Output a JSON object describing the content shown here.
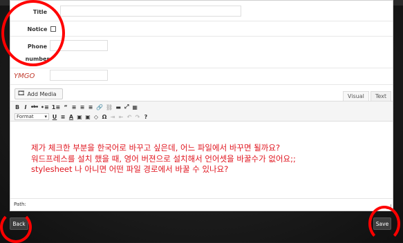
{
  "form": {
    "title_label": "Title",
    "title_value": "",
    "notice_label": "Notice",
    "notice_checked": false,
    "phone_label_1": "Phone",
    "phone_label_2": "number",
    "phone_value": "",
    "extra_label": "YMGO",
    "extra_value": ""
  },
  "editor": {
    "add_media_label": "Add Media",
    "tabs": [
      "Visual",
      "Text"
    ],
    "active_tab": "Visual",
    "toolbar_row1": [
      "B",
      "I",
      "abc",
      "•≡",
      "1≡",
      "“",
      "≡",
      "≡",
      "≡",
      "🔗",
      "⛓",
      "▬",
      "⤢",
      "▦"
    ],
    "toolbar_row2_format": "Format",
    "toolbar_row2": [
      "U",
      "≡",
      "A",
      "▣",
      "▣",
      "◇",
      "Ω",
      "⇥",
      "⇤",
      "↶",
      "↷",
      "?"
    ],
    "content_lines": [
      "제가 체크한 부분을 한국어로 바꾸고 싶은데, 어느 파일에서 바꾸면 될까요?",
      "워드프레스를 설치 했을 때, 영어 버젼으로 설치해서 언어셋을 바꿀수가 없어요;;",
      "stylesheet 나 아니면  어떤 파일 경로에서 바꿀 수 있나요?"
    ],
    "content_color": "#e0141e",
    "path_label": "Path:"
  },
  "actions": {
    "back_label": "Back",
    "save_label": "Save"
  },
  "annotation_color": "#ff0000"
}
